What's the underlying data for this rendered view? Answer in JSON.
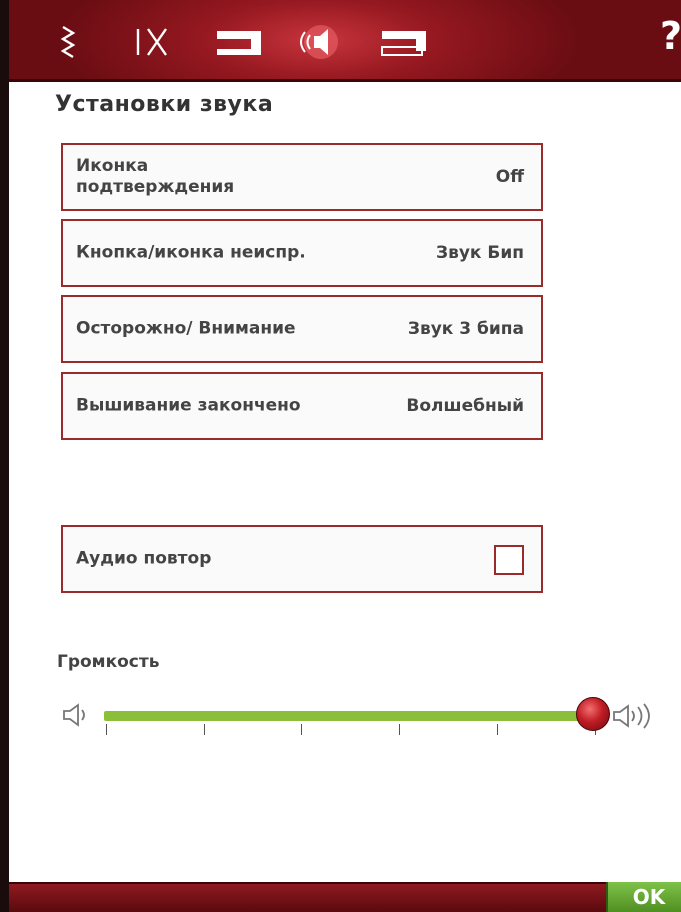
{
  "header": {
    "help_label": "?"
  },
  "page_title": "Установки звука",
  "settings": [
    {
      "label": "Иконка подтверждения",
      "value": "Off"
    },
    {
      "label": "Кнопка/иконка неиспр.",
      "value": "Звук Бип"
    },
    {
      "label": "Осторожно/ Внимание",
      "value": "Звук 3 бипа"
    },
    {
      "label": "Вышивание закончено",
      "value": "Волшебный"
    }
  ],
  "audio_repeat": {
    "label": "Аудио повтор",
    "checked": false
  },
  "volume": {
    "label": "Громкость",
    "level_fraction": 1.0,
    "tick_count": 6
  },
  "footer": {
    "ok_label": "OK"
  },
  "colors": {
    "accent": "#9b2a2a",
    "slider": "#8bbf3a",
    "ok": "#6aa935"
  }
}
